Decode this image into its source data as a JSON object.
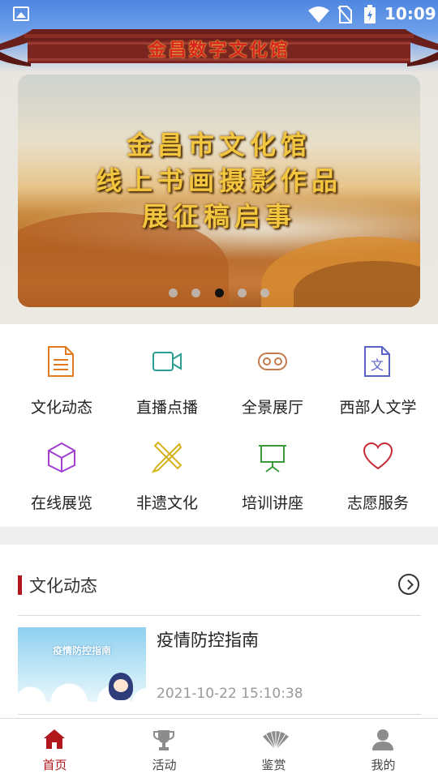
{
  "status_bar": {
    "time": "10:09"
  },
  "header": {
    "title": "金昌数字文化馆"
  },
  "banner": {
    "lines": [
      "金昌市文化馆",
      "线上书画摄影作品",
      "展征稿启事"
    ],
    "slides_total": 5,
    "active_slide": 3
  },
  "menu": {
    "items": [
      {
        "label": "文化动态",
        "icon": "document-icon",
        "color": "#e07a1f"
      },
      {
        "label": "直播点播",
        "icon": "video-camera-icon",
        "color": "#2a9d8f"
      },
      {
        "label": "全景展厅",
        "icon": "vr-glasses-icon",
        "color": "#c47a4a"
      },
      {
        "label": "西部人文学",
        "icon": "literature-file-icon",
        "color": "#5b63c7"
      },
      {
        "label": "在线展览",
        "icon": "cube-icon",
        "color": "#a33fd0"
      },
      {
        "label": "非遗文化",
        "icon": "craft-tools-icon",
        "color": "#d4b21b"
      },
      {
        "label": "培训讲座",
        "icon": "presentation-board-icon",
        "color": "#3a9a3a"
      },
      {
        "label": "志愿服务",
        "icon": "heart-icon",
        "color": "#c82a35"
      }
    ]
  },
  "news": {
    "section_title": "文化动态",
    "items": [
      {
        "title": "疫情防控指南",
        "date": "2021-10-22 15:10:38",
        "thumb_title": "疫情防控指南"
      }
    ]
  },
  "bottom_nav": {
    "items": [
      {
        "label": "首页",
        "icon": "home-icon",
        "active": true
      },
      {
        "label": "活动",
        "icon": "trophy-icon",
        "active": false
      },
      {
        "label": "鉴赏",
        "icon": "fan-icon",
        "active": false
      },
      {
        "label": "我的",
        "icon": "user-icon",
        "active": false
      }
    ],
    "active_color": "#b0161b"
  }
}
